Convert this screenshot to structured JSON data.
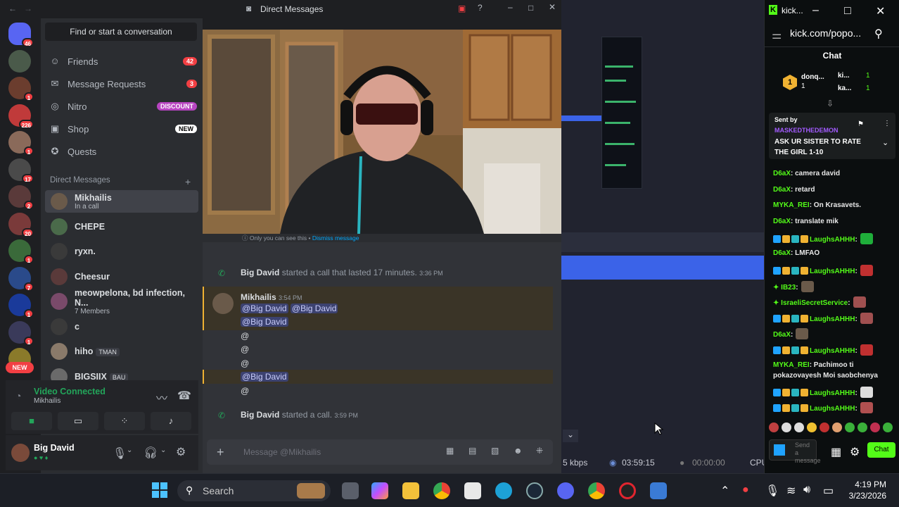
{
  "discord": {
    "title": "Direct Messages",
    "find_placeholder": "Find or start a conversation",
    "servers": [
      {
        "badge": "46",
        "color": "#5865f2"
      },
      {
        "badge": "",
        "color": "#4a5a4a"
      },
      {
        "badge": "1",
        "color": "#6b3d2e"
      },
      {
        "badge": "226",
        "color": "#c03a3a"
      },
      {
        "badge": "1",
        "color": "#8a6a5a"
      },
      {
        "badge": "17",
        "color": "#4a4a4a"
      },
      {
        "badge": "2",
        "color": "#5a3a3a"
      },
      {
        "badge": "20",
        "color": "#7a3a3a"
      },
      {
        "badge": "1",
        "color": "#3a6a3a"
      },
      {
        "badge": "7",
        "color": "#2a4a8a"
      },
      {
        "badge": "1",
        "color": "#1a3a9a"
      },
      {
        "badge": "1",
        "color": "#3a3a5a"
      },
      {
        "badge": "1",
        "color": "#8a7a2a"
      }
    ],
    "new_label": "NEW",
    "nav": [
      {
        "icon": "friends-icon",
        "glyph": "☺",
        "label": "Friends",
        "badge": "42"
      },
      {
        "icon": "mail-icon",
        "glyph": "✉",
        "label": "Message Requests",
        "badge": "3"
      },
      {
        "icon": "nitro-icon",
        "glyph": "◎",
        "label": "Nitro",
        "badge": "DISCOUNT"
      },
      {
        "icon": "shop-icon",
        "glyph": "▣",
        "label": "Shop",
        "badge": "NEW"
      },
      {
        "icon": "quests-icon",
        "glyph": "✪",
        "label": "Quests",
        "badge": ""
      }
    ],
    "dm_header": "Direct Messages",
    "dms": [
      {
        "name": "Mikhailis",
        "sub": "In a call",
        "tag": "",
        "color": "#6a5a4a"
      },
      {
        "name": "CHEPE",
        "sub": "",
        "tag": "",
        "color": "#4a6a4a"
      },
      {
        "name": "ryxn.",
        "sub": "",
        "tag": "",
        "color": "#3a3a3a"
      },
      {
        "name": "Cheesur",
        "sub": "",
        "tag": "",
        "color": "#5a3a3a"
      },
      {
        "name": "meowpelona, bd infection, N...",
        "sub": "7 Members",
        "tag": "",
        "color": "#7a4a6a"
      },
      {
        "name": "c",
        "sub": "",
        "tag": "",
        "color": "#3a3a3a"
      },
      {
        "name": "hiho",
        "sub": "",
        "tag": "TMAN",
        "color": "#8a7a6a"
      },
      {
        "name": "BIGSIIX",
        "sub": "",
        "tag": "BAU",
        "color": "#6a6a6a"
      }
    ],
    "voice": {
      "status": "Video Connected",
      "channel": "Mikhailis"
    },
    "user": {
      "name": "Big David"
    },
    "ephemeral": "Only you can see this •",
    "dismiss": "Dismiss message",
    "call1": {
      "author": "Big David",
      "text": "started a call that lasted 17 minutes.",
      "time": "3:36 PM"
    },
    "msg": {
      "author": "Mikhailis",
      "time": "3:54 PM",
      "mention": "@Big David",
      "at": "@"
    },
    "call2": {
      "author": "Big David",
      "text": "started a call.",
      "time": "3:59 PM"
    },
    "composer_placeholder": "Message @Mikhailis"
  },
  "obs": {
    "bitrate": "5 kbps",
    "timer1": "03:59:15",
    "timer2": "00:00:00",
    "cpu": "CPU"
  },
  "kick": {
    "title": "kick...",
    "url": "kick.com/popo...",
    "chat_title": "Chat",
    "top": [
      {
        "name": "donq...",
        "n": "1"
      },
      {
        "name": "ki...",
        "n": "1"
      },
      {
        "name": "ka...",
        "n": "1"
      }
    ],
    "pinned": {
      "label": "Sent by",
      "user": "MASKEDTHEDEMON",
      "text": "ASK UR SISTER TO RATE THE GIRL 1-10"
    },
    "messages": [
      {
        "user": "D6aX",
        "text": "camera david",
        "color": "#53fc18",
        "badges": 0,
        "emote": ""
      },
      {
        "user": "D6aX",
        "text": "retard",
        "color": "#53fc18",
        "badges": 0,
        "emote": ""
      },
      {
        "user": "MYKA_REI",
        "text": "On Krasavets.",
        "color": "#53fc18",
        "badges": 0,
        "emote": ""
      },
      {
        "user": "D6aX",
        "text": "translate mik",
        "color": "#53fc18",
        "badges": 0,
        "emote": ""
      },
      {
        "user": "LaughsAHHH",
        "text": "",
        "color": "#53fc18",
        "badges": 4,
        "emote": "#1fae3a"
      },
      {
        "user": "D6aX",
        "text": "LMFAO",
        "color": "#53fc18",
        "badges": 0,
        "emote": ""
      },
      {
        "user": "LaughsAHHH",
        "text": "",
        "color": "#53fc18",
        "badges": 4,
        "emote": "#c03030"
      },
      {
        "user": "IB23",
        "text": "",
        "color": "#53fc18",
        "badges": 1,
        "emote": "#6a5a4a"
      },
      {
        "user": "IsraeliSecretService",
        "text": "",
        "color": "#53fc18",
        "badges": 1,
        "emote": "#a05050"
      },
      {
        "user": "LaughsAHHH",
        "text": "",
        "color": "#53fc18",
        "badges": 4,
        "emote": "#a05050"
      },
      {
        "user": "D6aX",
        "text": "",
        "color": "#53fc18",
        "badges": 0,
        "emote": "#6a5a4a"
      },
      {
        "user": "LaughsAHHH",
        "text": "",
        "color": "#53fc18",
        "badges": 4,
        "emote": "#c03030"
      }
    ],
    "myka2": {
      "user": "MYKA_REI",
      "text": "Pachimoo ti pokazovayesh Moi saobchenya"
    },
    "more": [
      {
        "user": "LaughsAHHH",
        "emote": "#dddddd"
      },
      {
        "user": "LaughsAHHH",
        "emote": "#b05050"
      }
    ],
    "send_placeholder": "Send a message",
    "send_button": "Chat"
  },
  "taskbar": {
    "search": "Search",
    "time": "4:19 PM",
    "date": "3/23/2026"
  }
}
